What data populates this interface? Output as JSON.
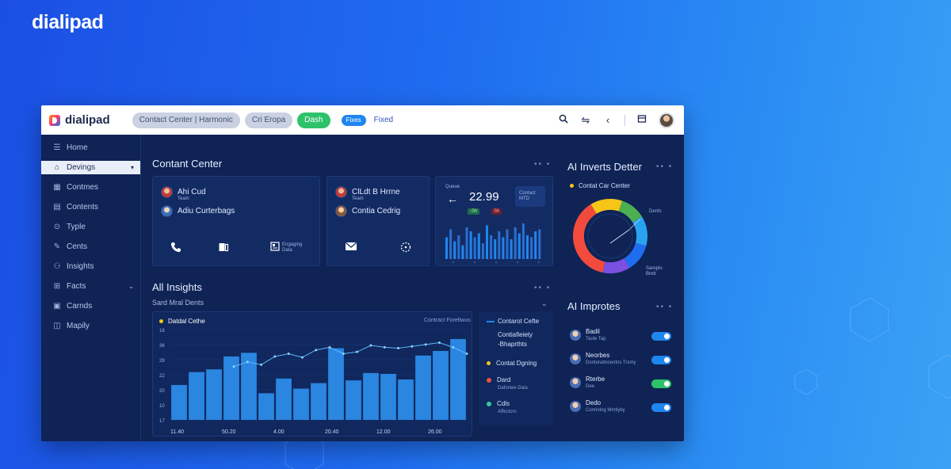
{
  "brand": {
    "name": "dialipad"
  },
  "app": {
    "title": "dialipad",
    "header_pills": [
      {
        "label": "Contact Center  |  Harmonic",
        "variant": "gray"
      },
      {
        "label": "Cri Eropa",
        "variant": "gray"
      },
      {
        "label": "Dash",
        "variant": "green"
      }
    ],
    "small_badge": "Fixes",
    "small_badge_label": "Fixed",
    "colors": {
      "accent": "#1f86f0",
      "green": "#2ec26b",
      "panel_bg": "#0f2355",
      "page_gradient_start": "#1b4fe3",
      "page_gradient_end": "#3aa2f5"
    },
    "top_icons": [
      "search-icon",
      "link-icon",
      "back-icon",
      "inbox-icon",
      "user-avatar"
    ]
  },
  "sidebar": {
    "items": [
      {
        "label": "Home",
        "icon": "list-icon"
      },
      {
        "label": "Devings",
        "icon": "home-icon",
        "active": true,
        "caret": "▾"
      },
      {
        "label": "Contmes",
        "icon": "building-icon"
      },
      {
        "label": "Contents",
        "icon": "document-icon"
      },
      {
        "label": "Typle",
        "icon": "shield-icon"
      },
      {
        "label": "Cents",
        "icon": "pen-icon"
      },
      {
        "label": "Insights",
        "icon": "people-icon"
      },
      {
        "label": "Facts",
        "icon": "tag-icon",
        "caret": "⌄"
      },
      {
        "label": "Carnds",
        "icon": "chat-icon"
      },
      {
        "label": "Mapily",
        "icon": "book-icon"
      }
    ]
  },
  "contact_center": {
    "title": "Contant Center",
    "card1": {
      "people": [
        {
          "name": "Ahi Cud",
          "sub": "Team"
        },
        {
          "name": "Adiu Curterbags",
          "sub": ""
        }
      ],
      "icons": [
        "phone-icon",
        "copy-icon",
        "grid-icon"
      ],
      "icon_caption": "Engaging\nData"
    },
    "card2": {
      "people": [
        {
          "name": "ClLdt B Hrrne",
          "sub": "Team"
        },
        {
          "name": "Contia Cedrig",
          "sub": ""
        }
      ],
      "icons": [
        "mail-icon",
        "dots-circle-icon"
      ]
    },
    "card3": {
      "label": "Queue",
      "value": "22.99",
      "mini_stat": "Contact\nMTD",
      "tags": [
        "-Sh",
        "Sh"
      ],
      "bars": [
        0.55,
        0.75,
        0.45,
        0.6,
        0.35,
        0.8,
        0.7,
        0.55,
        0.65,
        0.4,
        0.85,
        0.6,
        0.5,
        0.7,
        0.55,
        0.75,
        0.5,
        0.8,
        0.65,
        0.9,
        0.6,
        0.55,
        0.7,
        0.75
      ],
      "bar_colors": [
        "#1f86f0",
        "#2a6fd0"
      ]
    }
  },
  "ai_insights": {
    "title": "All Insights",
    "subtitle": "Sard Mral Dents",
    "chart_label": "Datdal Cethe",
    "chart_legend_right": "Contract Foreltwus",
    "chart_data": {
      "type": "bar",
      "y_ticks": [
        "18",
        "36",
        "29",
        "22",
        "20",
        "10",
        "17"
      ],
      "x_ticks": [
        "11.40",
        "50.20",
        "4.00",
        "20.40",
        "12.00",
        "26.00"
      ],
      "bar_values": [
        38,
        52,
        55,
        69,
        73,
        29,
        45,
        34,
        40,
        78,
        43,
        51,
        50,
        44,
        70,
        75,
        88
      ],
      "line_values": [
        58,
        63,
        60,
        69,
        72,
        68,
        76,
        79,
        72,
        74,
        81,
        79,
        78,
        80,
        82,
        84,
        79,
        72
      ],
      "ylim": [
        0,
        100
      ]
    },
    "legend": [
      {
        "title": "Contarot Cefte",
        "sub": "",
        "color": "#1f86f0",
        "type": "line"
      },
      {
        "title": "Contiafieiety\n-Bhaprthts",
        "sub": "",
        "color": "",
        "type": "text"
      },
      {
        "title": "Contat Dgning",
        "sub": "",
        "color": "#f5c518",
        "type": "dot"
      },
      {
        "title": "Dard",
        "sub": "Daforlwe Dala",
        "color": "#e8533f",
        "type": "dot"
      },
      {
        "title": "Cdls",
        "sub": "Affectors",
        "color": "#34c8a0",
        "type": "dot"
      }
    ]
  },
  "ai_inverts": {
    "title": "AI Inverts Detter",
    "legend_item": "Contat Car Center",
    "legend_color": "#f5c518",
    "donut_label_top": "Dents",
    "donut_label_bottom": "Sareplo\nBrett",
    "chart_data": {
      "type": "pie",
      "segments": [
        {
          "name": "Yellow",
          "value": 14,
          "color": "#f5c518"
        },
        {
          "name": "Green",
          "value": 11,
          "color": "#4caf50"
        },
        {
          "name": "Light Blue",
          "value": 13,
          "color": "#29a3f0"
        },
        {
          "name": "Blue",
          "value": 12,
          "color": "#1f6df0"
        },
        {
          "name": "Purple",
          "value": 12,
          "color": "#7b4fe0"
        },
        {
          "name": "Red",
          "value": 38,
          "color": "#f24b3d"
        }
      ]
    }
  },
  "ai_improtes": {
    "title": "AI Improtes",
    "items": [
      {
        "name": "Badil",
        "sub": "Taole Tap",
        "toggle": "blue"
      },
      {
        "name": "Neorbes",
        "sub": "Dontoralmcentns Trsmy",
        "toggle": "blue"
      },
      {
        "name": "Rterbe",
        "sub": "Dee",
        "toggle": "green"
      },
      {
        "name": "Dedo",
        "sub": "Conrining Mmtlyby",
        "toggle": "blue"
      }
    ]
  }
}
